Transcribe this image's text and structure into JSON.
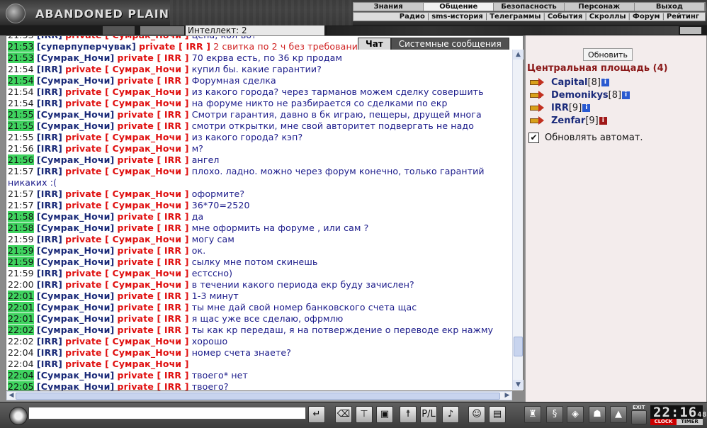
{
  "app": {
    "logo_text": "ABANDONED PLAIN"
  },
  "menu": {
    "main": [
      "Знания",
      "Общение",
      "Безопасность",
      "Персонаж",
      "Выход"
    ],
    "active_index": 1,
    "sub": [
      "Радио",
      "sms-история",
      "Телеграммы",
      "События",
      "Скроллы",
      "Форум",
      "Рейтинг"
    ]
  },
  "info": {
    "intellect": "Интеллект: 2"
  },
  "chat": {
    "tabs": [
      "Чат",
      "Системные сообщения"
    ],
    "private_tag": "private",
    "lines": [
      {
        "time": "21:53",
        "hl": false,
        "nick": "IRR",
        "to": "Сумрак_Ночи",
        "msg": "цена, кол-во?"
      },
      {
        "time": "21:53",
        "hl": true,
        "nick": "суперпуперчувак",
        "to": "IRR",
        "msg": "2 свитка по 2 ч без требований",
        "red": true
      },
      {
        "time": "21:53",
        "hl": true,
        "nick": "Сумрак_Ночи",
        "to": "IRR",
        "msg": "70 екрва есть, по 36 кр продам"
      },
      {
        "time": "21:54",
        "hl": false,
        "nick": "IRR",
        "to": "Сумрак_Ночи",
        "msg": "купил бы. какие гарантии?"
      },
      {
        "time": "21:54",
        "hl": true,
        "nick": "Сумрак_Ночи",
        "to": "IRR",
        "msg": "Форумная сделка"
      },
      {
        "time": "21:54",
        "hl": false,
        "nick": "IRR",
        "to": "Сумрак_Ночи",
        "msg": "из какого города? через тарманов можем сделку совершить"
      },
      {
        "time": "21:54",
        "hl": false,
        "nick": "IRR",
        "to": "Сумрак_Ночи",
        "msg": "на форуме никто не разбирается со сделками по екр"
      },
      {
        "time": "21:55",
        "hl": true,
        "nick": "Сумрак_Ночи",
        "to": "IRR",
        "msg": "Смотри гарантия, давно в бк играю, пещеры, друщей многа"
      },
      {
        "time": "21:55",
        "hl": true,
        "nick": "Сумрак_Ночи",
        "to": "IRR",
        "msg": "смотри открытки, мне свой авторитет подвергать не надо"
      },
      {
        "time": "21:55",
        "hl": false,
        "nick": "IRR",
        "to": "Сумрак_Ночи",
        "msg": "из какого города? кэп?"
      },
      {
        "time": "21:56",
        "hl": false,
        "nick": "IRR",
        "to": "Сумрак_Ночи",
        "msg": "м?"
      },
      {
        "time": "21:56",
        "hl": true,
        "nick": "Сумрак_Ночи",
        "to": "IRR",
        "msg": "ангел"
      },
      {
        "time": "21:57",
        "hl": false,
        "nick": "IRR",
        "to": "Сумрак_Ночи",
        "msg": "плохо. ладно. можно через форум конечно, только гарантий никаких :(",
        "wrap": true
      },
      {
        "time": "21:57",
        "hl": false,
        "nick": "IRR",
        "to": "Сумрак_Ночи",
        "msg": "оформите?"
      },
      {
        "time": "21:57",
        "hl": false,
        "nick": "IRR",
        "to": "Сумрак_Ночи",
        "msg": "36*70=2520"
      },
      {
        "time": "21:58",
        "hl": true,
        "nick": "Сумрак_Ночи",
        "to": "IRR",
        "msg": "да"
      },
      {
        "time": "21:58",
        "hl": true,
        "nick": "Сумрак_Ночи",
        "to": "IRR",
        "msg": "мне оформить на форуме , или сам ?"
      },
      {
        "time": "21:59",
        "hl": false,
        "nick": "IRR",
        "to": "Сумрак_Ночи",
        "msg": "могу сам"
      },
      {
        "time": "21:59",
        "hl": true,
        "nick": "Сумрак_Ночи",
        "to": "IRR",
        "msg": "ок."
      },
      {
        "time": "21:59",
        "hl": true,
        "nick": "Сумрак_Ночи",
        "to": "IRR",
        "msg": "сылку мне потом скинешь"
      },
      {
        "time": "21:59",
        "hl": false,
        "nick": "IRR",
        "to": "Сумрак_Ночи",
        "msg": "естссно)"
      },
      {
        "time": "22:00",
        "hl": false,
        "nick": "IRR",
        "to": "Сумрак_Ночи",
        "msg": "в течении какого периода екр буду зачислен?"
      },
      {
        "time": "22:01",
        "hl": true,
        "nick": "Сумрак_Ночи",
        "to": "IRR",
        "msg": "1-3 минут"
      },
      {
        "time": "22:01",
        "hl": true,
        "nick": "Сумрак_Ночи",
        "to": "IRR",
        "msg": "ты мне дай свой номер банковского счета щас"
      },
      {
        "time": "22:01",
        "hl": true,
        "nick": "Сумрак_Ночи",
        "to": "IRR",
        "msg": "я щас уже все сделаю, офрмлю"
      },
      {
        "time": "22:02",
        "hl": true,
        "nick": "Сумрак_Ночи",
        "to": "IRR",
        "msg": "ты как кр передаш, я на потверждение о переводе екр нажму"
      },
      {
        "time": "22:02",
        "hl": false,
        "nick": "IRR",
        "to": "Сумрак_Ночи",
        "msg": "хорошо"
      },
      {
        "time": "22:04",
        "hl": false,
        "nick": "IRR",
        "to": "Сумрак_Ночи",
        "msg": "номер счета знаете?"
      },
      {
        "time": "22:04",
        "hl": false,
        "nick": "IRR",
        "to": "Сумрак_Ночи",
        "msg": ""
      },
      {
        "time": "22:04",
        "hl": true,
        "nick": "Сумрак_Ночи",
        "to": "IRR",
        "msg": "твоего* нет"
      },
      {
        "time": "22:05",
        "hl": true,
        "nick": "Сумрак_Ночи",
        "to": "IRR",
        "msg": "твоего?"
      }
    ],
    "input_value": ""
  },
  "panel": {
    "refresh_label": "Обновить",
    "room_title": "Центральная площадь (4)",
    "users": [
      {
        "name": "Capital",
        "level": "[8]",
        "info": "i",
        "red": false
      },
      {
        "name": "Demonikys",
        "level": "[8]",
        "info": "i",
        "red": false
      },
      {
        "name": "IRR",
        "level": "[9]",
        "info": "i",
        "red": false
      },
      {
        "name": "Zenfar",
        "level": "[9]",
        "info": "i",
        "red": true
      }
    ],
    "auto_update_label": "Обновлять автомат.",
    "auto_update_checked": true
  },
  "toolbar": {
    "buttons": [
      {
        "name": "send-icon",
        "glyph": "↵"
      },
      {
        "name": "eraser-icon",
        "glyph": "⌫"
      },
      {
        "name": "filter-icon",
        "glyph": "⊤"
      },
      {
        "name": "save-icon",
        "glyph": "▣"
      },
      {
        "name": "figure-icon",
        "glyph": "☨"
      },
      {
        "name": "translit-icon",
        "glyph": "Р/L"
      },
      {
        "name": "sound-icon",
        "glyph": "♪"
      },
      {
        "name": "smiley-icon",
        "glyph": "☺"
      },
      {
        "name": "speaker-icon",
        "glyph": "▤"
      }
    ],
    "right_buttons": [
      {
        "name": "bag-icon",
        "glyph": "♜"
      },
      {
        "name": "scroll-icon",
        "glyph": "§"
      },
      {
        "name": "map-icon",
        "glyph": "◈"
      },
      {
        "name": "helmet-icon",
        "glyph": "☗"
      },
      {
        "name": "lock-icon",
        "glyph": "▲"
      }
    ],
    "exit_label": "EXIT",
    "clock": {
      "time": "22:16",
      "seconds": "48",
      "clock_label": "CLOCK",
      "timer_label": "TIMER"
    }
  }
}
